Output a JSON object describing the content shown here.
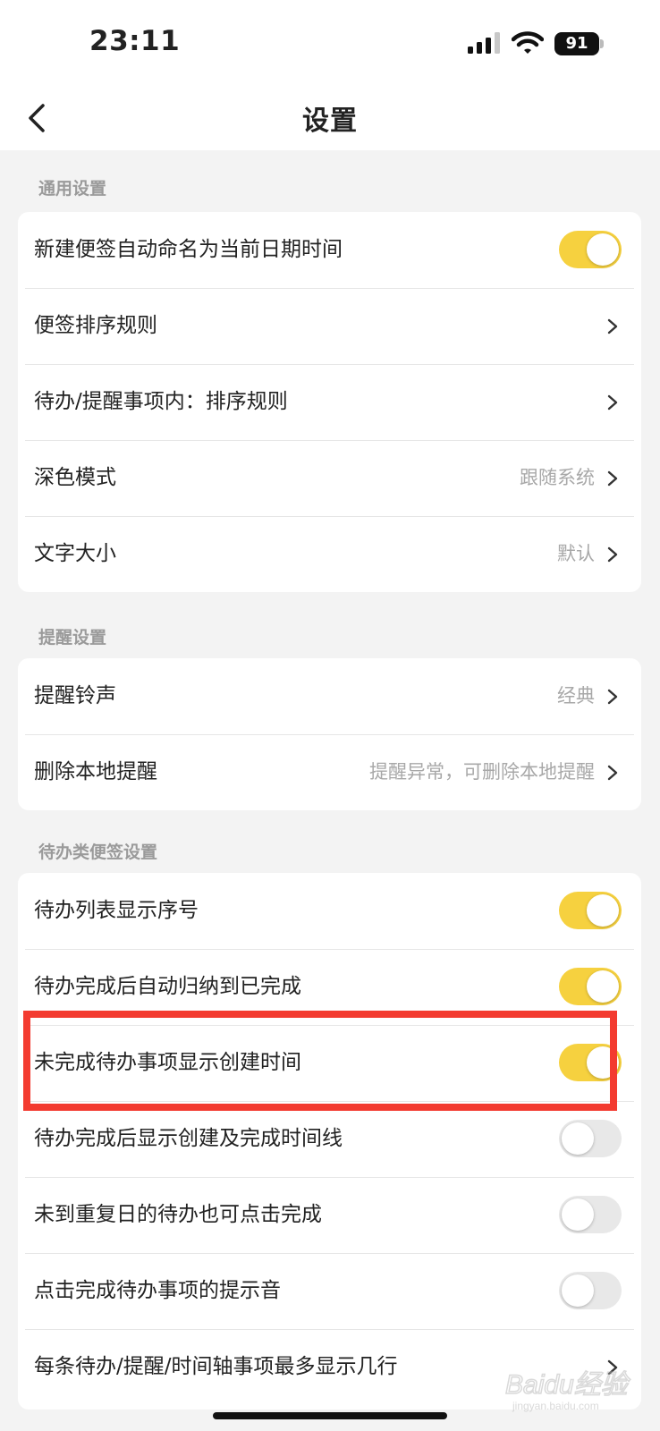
{
  "status_bar": {
    "time": "23:11",
    "battery": "91"
  },
  "nav": {
    "title": "设置"
  },
  "sections": {
    "general": {
      "title": "通用设置",
      "items": {
        "auto_name": {
          "label": "新建便签自动命名为当前日期时间",
          "on": true
        },
        "note_sort": {
          "label": "便签排序规则"
        },
        "todo_sort": {
          "label": "待办/提醒事项内：排序规则"
        },
        "dark_mode": {
          "label": "深色模式",
          "value": "跟随系统"
        },
        "font_size": {
          "label": "文字大小",
          "value": "默认"
        }
      }
    },
    "reminder": {
      "title": "提醒设置",
      "items": {
        "ringtone": {
          "label": "提醒铃声",
          "value": "经典"
        },
        "delete_local": {
          "label": "删除本地提醒",
          "value": "提醒异常，可删除本地提醒"
        }
      }
    },
    "todo": {
      "title": "待办类便签设置",
      "items": {
        "show_index": {
          "label": "待办列表显示序号",
          "on": true
        },
        "auto_archive": {
          "label": "待办完成后自动归纳到已完成",
          "on": true
        },
        "show_created": {
          "label": "未完成待办事项显示创建时间",
          "on": true
        },
        "show_timeline": {
          "label": "待办完成后显示创建及完成时间线",
          "on": false
        },
        "repeat_complete": {
          "label": "未到重复日的待办也可点击完成",
          "on": false
        },
        "complete_sound": {
          "label": "点击完成待办事项的提示音",
          "on": false
        },
        "max_lines": {
          "label": "每条待办/提醒/时间轴事项最多显示几行"
        }
      }
    }
  },
  "colors": {
    "accent": "#f6d13f",
    "highlight": "#f33b30",
    "background": "#f3f3f3"
  },
  "watermark": {
    "text": "Baidu经验",
    "sub": "jingyan.baidu.com"
  }
}
